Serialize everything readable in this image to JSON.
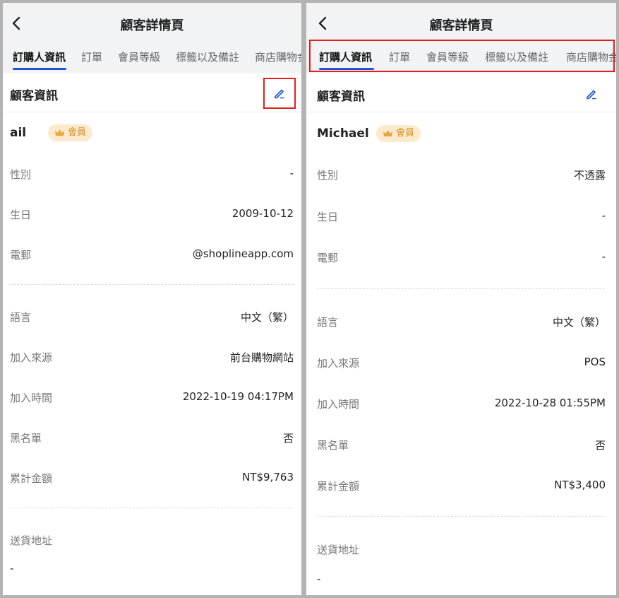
{
  "screens": [
    {
      "title": "顧客詳情頁",
      "tabs": [
        "訂購人資訊",
        "訂單",
        "會員等級",
        "標籤以及備註",
        "商店購物金"
      ],
      "section_title": "顧客資訊",
      "name": "ail",
      "badge": "會員",
      "rows_top": [
        {
          "label": "性別",
          "value": "-"
        },
        {
          "label": "生日",
          "value": "2009-10-12"
        },
        {
          "label": "電郵",
          "value": "@shoplineapp.com"
        }
      ],
      "rows_mid": [
        {
          "label": "語言",
          "value": "中文（繁）"
        },
        {
          "label": "加入來源",
          "value": "前台購物網站"
        },
        {
          "label": "加入時間",
          "value": "2022-10-19 04:17PM"
        },
        {
          "label": "黑名單",
          "value": "否"
        },
        {
          "label": "累計金額",
          "value": "NT$9,763"
        }
      ],
      "address_label": "送貨地址",
      "address_value": "-"
    },
    {
      "title": "顧客詳情頁",
      "tabs": [
        "訂購人資訊",
        "訂單",
        "會員等級",
        "標籤以及備註",
        "商店購物金"
      ],
      "section_title": "顧客資訊",
      "name": "Michael",
      "badge": "會員",
      "rows_top": [
        {
          "label": "性別",
          "value": "不透露"
        },
        {
          "label": "生日",
          "value": "-"
        },
        {
          "label": "電郵",
          "value": "-"
        }
      ],
      "rows_mid": [
        {
          "label": "語言",
          "value": "中文（繁）"
        },
        {
          "label": "加入來源",
          "value": "POS"
        },
        {
          "label": "加入時間",
          "value": "2022-10-28 01:55PM"
        },
        {
          "label": "黑名單",
          "value": "否"
        },
        {
          "label": "累計金額",
          "value": "NT$3,400"
        }
      ],
      "address_label": "送貨地址",
      "address_value": "-"
    }
  ],
  "colors": {
    "accent": "#1d55d3",
    "highlight_box": "#e0201e",
    "badge_bg": "#fde9cd",
    "badge_text": "#d6921e"
  },
  "icons": [
    "chevron-left-icon",
    "edit-pencil-icon",
    "crown-icon"
  ]
}
